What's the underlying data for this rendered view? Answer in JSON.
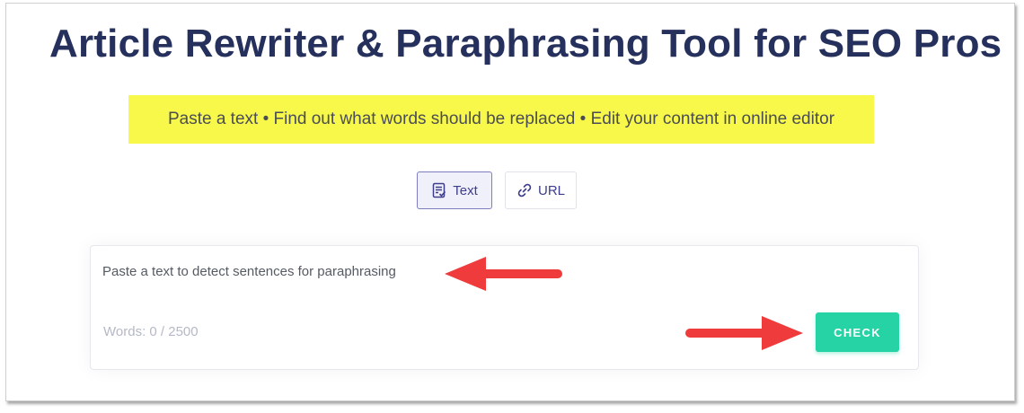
{
  "page": {
    "title": "Article Rewriter & Paraphrasing Tool for SEO Pros",
    "subtitle": "Paste a text • Find out what words should be replaced • Edit your content in online editor"
  },
  "tabs": [
    {
      "label": "Text",
      "icon": "document-check-icon",
      "selected": true
    },
    {
      "label": "URL",
      "icon": "link-icon",
      "selected": false
    }
  ],
  "editor": {
    "placeholder": "Paste a text to detect sentences for paraphrasing",
    "value": "",
    "word_count": "Words: 0 / 2500",
    "check_label": "CHECK"
  },
  "annotations": [
    {
      "icon": "red-arrow-left-icon"
    },
    {
      "icon": "red-arrow-right-icon"
    }
  ],
  "colors": {
    "title": "#25305c",
    "highlight": "#f7f84a",
    "tab_accent": "#3d3d8c",
    "button": "#26d3a4",
    "arrow": "#ef3b3b"
  }
}
